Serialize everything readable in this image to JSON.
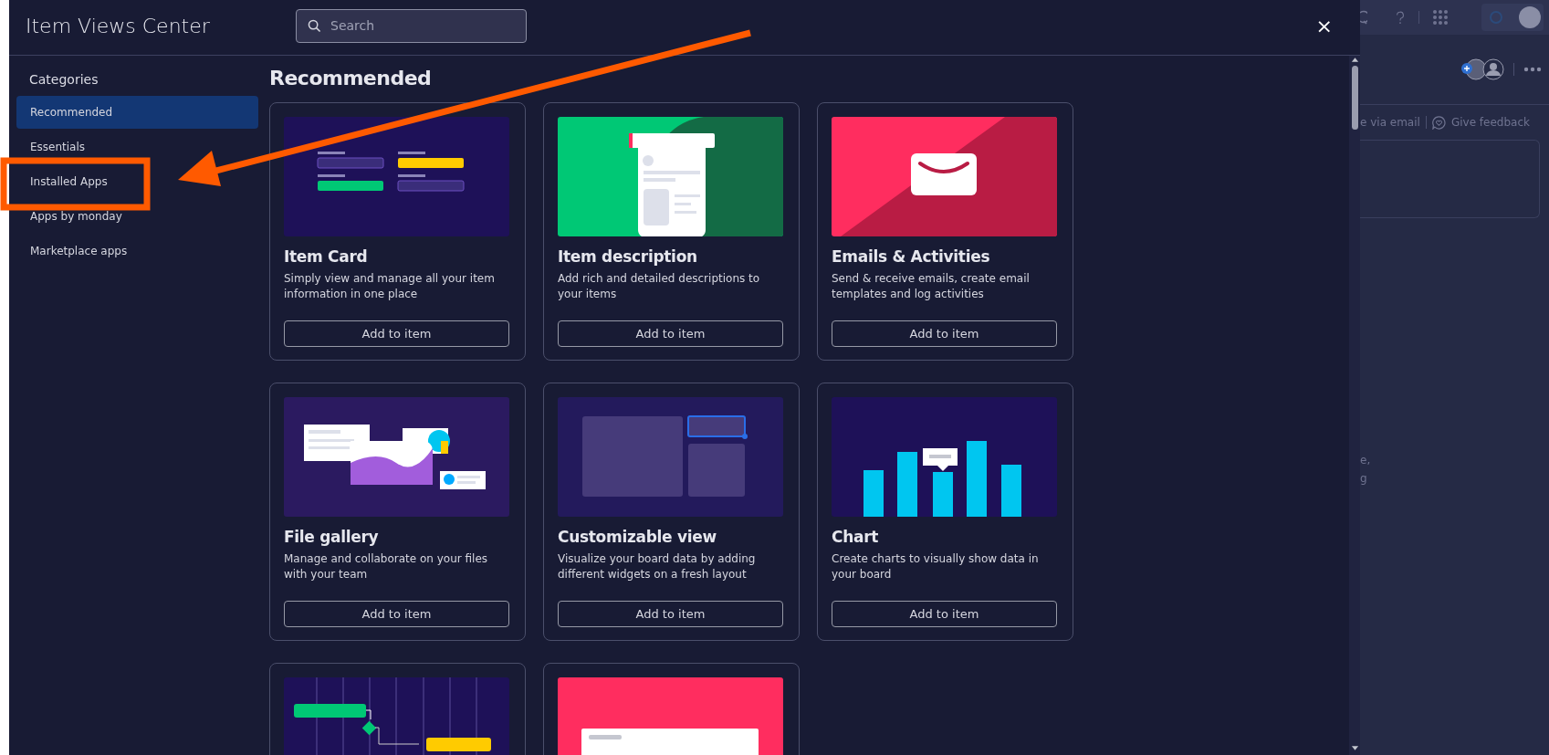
{
  "modal": {
    "title": "Item Views Center",
    "search": {
      "placeholder": "Search"
    },
    "close": "×"
  },
  "sidebar": {
    "heading": "Categories",
    "items": [
      {
        "label": "Recommended",
        "selected": true
      },
      {
        "label": "Essentials",
        "selected": false
      },
      {
        "label": "Installed Apps",
        "selected": false
      },
      {
        "label": "Apps by monday",
        "selected": false
      },
      {
        "label": "Marketplace apps",
        "selected": false
      }
    ]
  },
  "section": {
    "heading": "Recommended",
    "cards": [
      {
        "kind": "form",
        "title": "Item Card",
        "description": "Simply view and manage all your item information in one place",
        "button": "Add to item"
      },
      {
        "kind": "document",
        "title": "Item description",
        "description": "Add rich and detailed descriptions to your items",
        "button": "Add to item"
      },
      {
        "kind": "envelope",
        "title": "Emails & Activities",
        "description": "Send & receive emails, create email templates and log activities",
        "button": "Add to item"
      },
      {
        "kind": "files",
        "title": "File gallery",
        "description": "Manage and collaborate on your files with your team",
        "button": "Add to item"
      },
      {
        "kind": "widgets",
        "title": "Customizable view",
        "description": "Visualize your board data by adding different widgets on a fresh layout",
        "button": "Add to item"
      },
      {
        "kind": "bars",
        "title": "Chart",
        "description": "Create charts to visually show data in your board",
        "button": "Add to item"
      },
      {
        "kind": "timeline"
      },
      {
        "kind": "panel"
      }
    ]
  },
  "background": {
    "email_link": "e via email",
    "feedback": "Give feedback",
    "fragment_1": "e,",
    "fragment_2": "g"
  }
}
